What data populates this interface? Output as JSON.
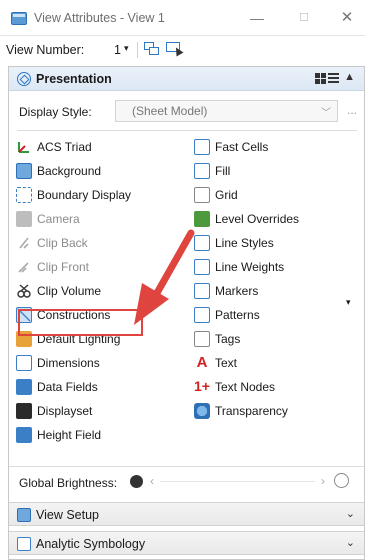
{
  "window": {
    "title": "View Attributes - View 1",
    "minimize": "—",
    "maximize": "☐",
    "close": "✕"
  },
  "toolbar": {
    "view_number_label": "View Number:",
    "view_number_value": "1"
  },
  "sections": [
    {
      "title": "Presentation",
      "expanded": true
    },
    {
      "title": "View Setup",
      "expanded": false
    },
    {
      "title": "Analytic Symbology",
      "expanded": false
    }
  ],
  "display_style": {
    "label": "Display Style:",
    "value": "(Sheet Model)",
    "more": "..."
  },
  "items_left": [
    {
      "label": "ACS Triad",
      "icon": "acs-triad-icon",
      "enabled": true
    },
    {
      "label": "Background",
      "icon": "background-icon",
      "enabled": true
    },
    {
      "label": "Boundary Display",
      "icon": "boundary-display-icon",
      "enabled": true
    },
    {
      "label": "Camera",
      "icon": "camera-icon",
      "enabled": false
    },
    {
      "label": "Clip Back",
      "icon": "clip-back-icon",
      "enabled": false
    },
    {
      "label": "Clip Front",
      "icon": "clip-front-icon",
      "enabled": false
    },
    {
      "label": "Clip Volume",
      "icon": "clip-volume-icon",
      "enabled": true
    },
    {
      "label": "Constructions",
      "icon": "constructions-icon",
      "enabled": true
    },
    {
      "label": "Default Lighting",
      "icon": "default-lighting-icon",
      "enabled": true
    },
    {
      "label": "Dimensions",
      "icon": "dimensions-icon",
      "enabled": true
    },
    {
      "label": "Data Fields",
      "icon": "data-fields-icon",
      "enabled": true
    },
    {
      "label": "Displayset",
      "icon": "displayset-icon",
      "enabled": true
    },
    {
      "label": "Height Field",
      "icon": "height-field-icon",
      "enabled": true
    }
  ],
  "items_right": [
    {
      "label": "Fast Cells",
      "icon": "fast-cells-icon",
      "enabled": true
    },
    {
      "label": "Fill",
      "icon": "fill-icon",
      "enabled": true
    },
    {
      "label": "Grid",
      "icon": "grid-icon",
      "enabled": true
    },
    {
      "label": "Level Overrides",
      "icon": "level-overrides-icon",
      "enabled": true
    },
    {
      "label": "Line Styles",
      "icon": "line-styles-icon",
      "enabled": true
    },
    {
      "label": "Line Weights",
      "icon": "line-weights-icon",
      "enabled": true
    },
    {
      "label": "Markers",
      "icon": "markers-icon",
      "enabled": true
    },
    {
      "label": "Patterns",
      "icon": "patterns-icon",
      "enabled": true
    },
    {
      "label": "Tags",
      "icon": "tags-icon",
      "enabled": true
    },
    {
      "label": "Text",
      "icon": "text-icon",
      "enabled": true
    },
    {
      "label": "Text Nodes",
      "icon": "text-nodes-icon",
      "enabled": true
    },
    {
      "label": "Transparency",
      "icon": "transparency-icon",
      "enabled": true
    }
  ],
  "global_brightness": {
    "label": "Global Brightness:"
  },
  "colors": {
    "accent": "#3b7fc6",
    "highlight": "#e0443e"
  }
}
